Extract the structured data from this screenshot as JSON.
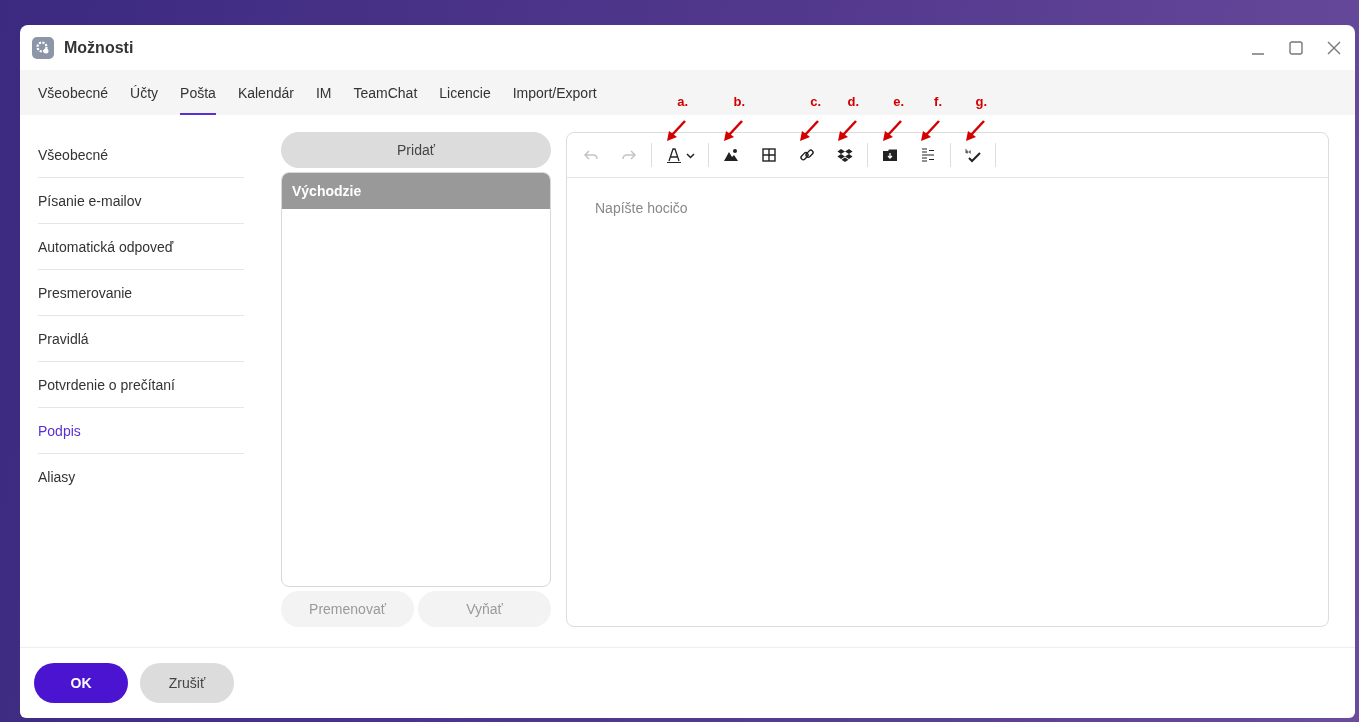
{
  "window": {
    "title": "Možnosti"
  },
  "tabs": [
    {
      "label": "Všeobecné",
      "selected": false
    },
    {
      "label": "Účty",
      "selected": false
    },
    {
      "label": "Pošta",
      "selected": true
    },
    {
      "label": "Kalendár",
      "selected": false
    },
    {
      "label": "IM",
      "selected": false
    },
    {
      "label": "TeamChat",
      "selected": false
    },
    {
      "label": "Licencie",
      "selected": false
    },
    {
      "label": "Import/Export",
      "selected": false
    }
  ],
  "sidebar": {
    "items": [
      {
        "label": "Všeobecné",
        "selected": false
      },
      {
        "label": "Písanie e-mailov",
        "selected": false
      },
      {
        "label": "Automatická odpoveď",
        "selected": false
      },
      {
        "label": "Presmerovanie",
        "selected": false
      },
      {
        "label": "Pravidlá",
        "selected": false
      },
      {
        "label": "Potvrdenie o prečítaní",
        "selected": false
      },
      {
        "label": "Podpis",
        "selected": true
      },
      {
        "label": "Aliasy",
        "selected": false
      }
    ]
  },
  "signatures": {
    "add_button": "Pridať",
    "items": [
      {
        "label": "Východzie",
        "selected": true
      }
    ],
    "buttons": [
      {
        "label": "Premenovať",
        "disabled": true
      },
      {
        "label": "Vyňať",
        "disabled": true
      }
    ]
  },
  "editor": {
    "toolbar": [
      {
        "kind": "undo",
        "disabled": true
      },
      {
        "kind": "redo",
        "disabled": true
      },
      {
        "kind": "separator"
      },
      {
        "kind": "font-color",
        "disabled": false,
        "annotation": "a."
      },
      {
        "kind": "separator"
      },
      {
        "kind": "image",
        "disabled": false,
        "annotation": "b."
      },
      {
        "kind": "table",
        "disabled": false
      },
      {
        "kind": "link",
        "disabled": false,
        "annotation": "c."
      },
      {
        "kind": "dropbox",
        "disabled": false,
        "annotation": "d."
      },
      {
        "kind": "separator"
      },
      {
        "kind": "box",
        "disabled": false,
        "annotation": "e."
      },
      {
        "kind": "format",
        "disabled": false,
        "annotation": "f."
      },
      {
        "kind": "separator"
      },
      {
        "kind": "spellcheck",
        "disabled": false,
        "annotation": "g."
      },
      {
        "kind": "separator"
      }
    ],
    "placeholder": "Napíšte hocičo"
  },
  "footer": {
    "buttons": [
      {
        "label": "OK",
        "kind": "primary"
      },
      {
        "label": "Zrušiť",
        "kind": "secondary"
      }
    ]
  }
}
